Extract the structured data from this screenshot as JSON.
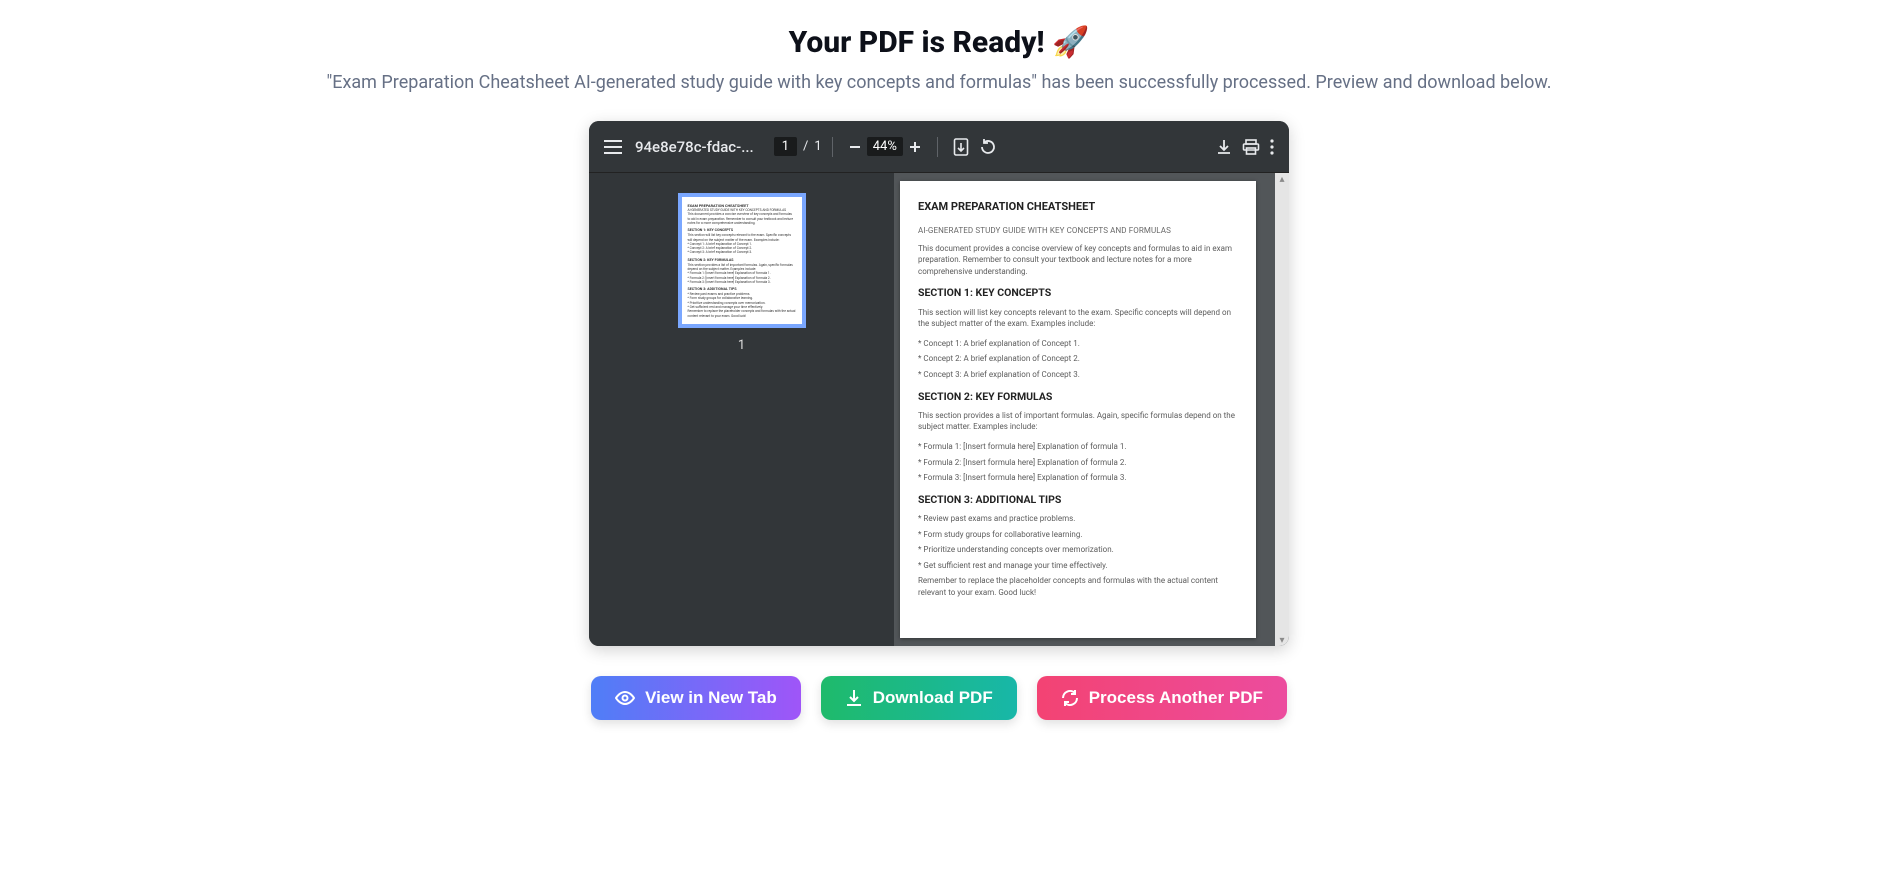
{
  "header": {
    "title": "Your PDF is Ready! 🚀",
    "subtitle": "\"Exam Preparation Cheatsheet AI-generated study guide with key concepts and formulas\" has been successfully processed. Preview and download below."
  },
  "viewer": {
    "filename": "94e8e78c-fdac-...",
    "page_current": "1",
    "page_total": "1",
    "page_sep": "/",
    "zoom": "44%",
    "thumb_label": "1"
  },
  "document": {
    "title": "EXAM PREPARATION CHEATSHEET",
    "subtitle": "AI-GENERATED STUDY GUIDE WITH KEY CONCEPTS AND FORMULAS",
    "intro": "This document provides a concise overview of key concepts and formulas to aid in exam preparation.  Remember to consult your textbook and lecture notes for a more comprehensive understanding.",
    "s1_heading": "SECTION 1: KEY CONCEPTS",
    "s1_intro": "This section will list key concepts relevant to the exam.  Specific concepts will depend on the subject matter of the exam.  Examples include:",
    "s1_b1": "*   Concept 1:  A brief explanation of Concept 1.",
    "s1_b2": "*   Concept 2:  A brief explanation of Concept 2.",
    "s1_b3": "*   Concept 3: A brief explanation of Concept 3.",
    "s2_heading": "SECTION 2: KEY FORMULAS",
    "s2_intro": "This section provides a list of important formulas. Again, specific formulas depend on the subject matter.  Examples include:",
    "s2_b1": "*   Formula 1:  [Insert formula here]  Explanation of formula 1.",
    "s2_b2": "*   Formula 2:  [Insert formula here]  Explanation of formula 2.",
    "s2_b3": "*   Formula 3:  [Insert formula here] Explanation of formula 3.",
    "s3_heading": "SECTION 3:  ADDITIONAL TIPS",
    "s3_b1": "*   Review past exams and practice problems.",
    "s3_b2": "*   Form study groups for collaborative learning.",
    "s3_b3": "*   Prioritize understanding concepts over memorization.",
    "s3_b4": "*   Get sufficient rest and manage your time effectively.",
    "outro": "Remember to replace the placeholder concepts and formulas with the actual content relevant to your exam.  Good luck!"
  },
  "actions": {
    "view": "View in New Tab",
    "download": "Download PDF",
    "another": "Process Another PDF"
  }
}
